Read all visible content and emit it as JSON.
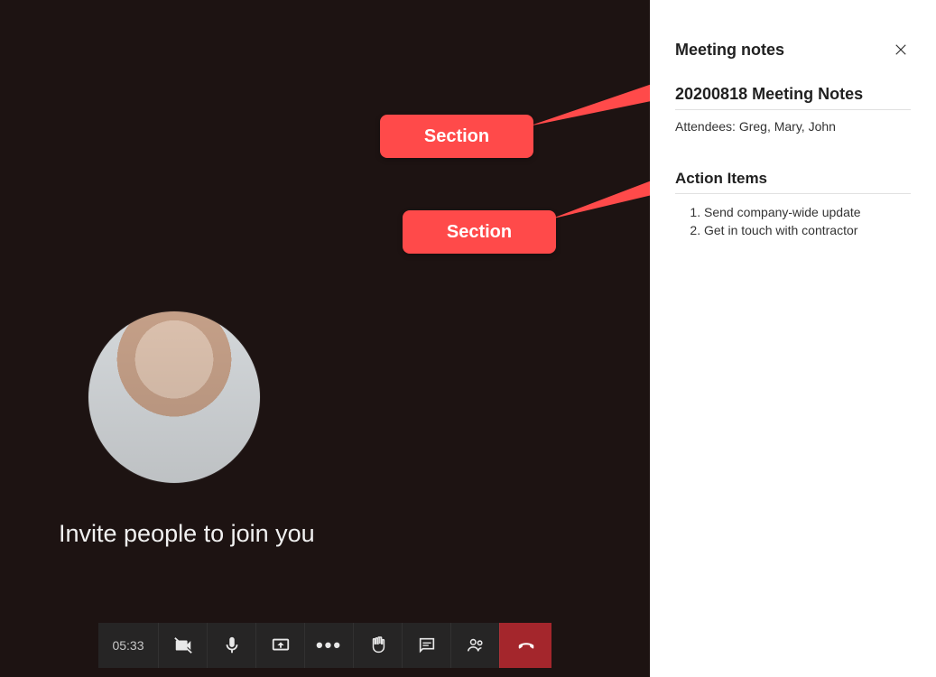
{
  "stage": {
    "invite_text": "Invite people to join you"
  },
  "callouts": {
    "c1": "Section",
    "c2": "Section"
  },
  "controls": {
    "timer": "05:33"
  },
  "panel": {
    "title": "Meeting notes",
    "section1_title": "20200818 Meeting Notes",
    "attendees": "Attendees: Greg, Mary, John",
    "section2_title": "Action Items",
    "actions": [
      "Send company-wide update",
      "Get in touch with contractor"
    ]
  }
}
